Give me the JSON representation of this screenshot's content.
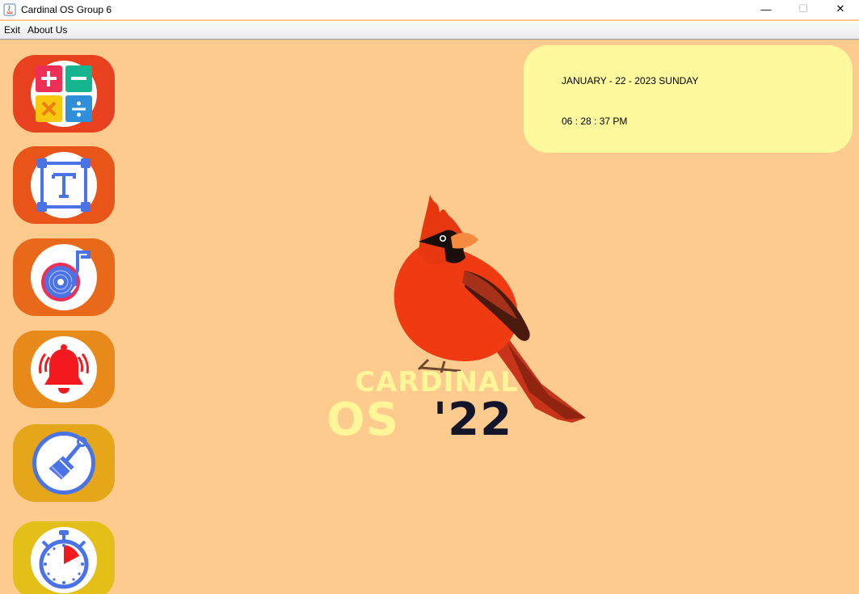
{
  "window": {
    "title": "Cardinal OS Group 6",
    "controls": {
      "minimize": "—",
      "maximize": "☐",
      "close": "✕"
    }
  },
  "menu": {
    "items": [
      "Exit",
      "About Us"
    ]
  },
  "launcher": {
    "apps": [
      {
        "icon": "calculator-icon",
        "tile_color": "#e8411f"
      },
      {
        "icon": "text-editor-icon",
        "tile_color": "#e95418"
      },
      {
        "icon": "music-player-icon",
        "tile_color": "#e9691b"
      },
      {
        "icon": "alarm-bell-icon",
        "tile_color": "#e88a1a"
      },
      {
        "icon": "paint-brush-icon",
        "tile_color": "#e5a619"
      },
      {
        "icon": "stopwatch-icon",
        "tile_color": "#e4bf18"
      }
    ]
  },
  "clock": {
    "date": "JANUARY - 22 - 2023 SUNDAY",
    "time": "06 : 28 : 37 PM"
  },
  "logo": {
    "line1": "CARDINAL",
    "os": "OS",
    "year": "'22"
  },
  "colors": {
    "desktop": "#fecb8f",
    "clock_widget": "#fef99d",
    "logo_light": "#fff699",
    "logo_dark": "#13152a",
    "cardinal_red": "#f03a12"
  }
}
